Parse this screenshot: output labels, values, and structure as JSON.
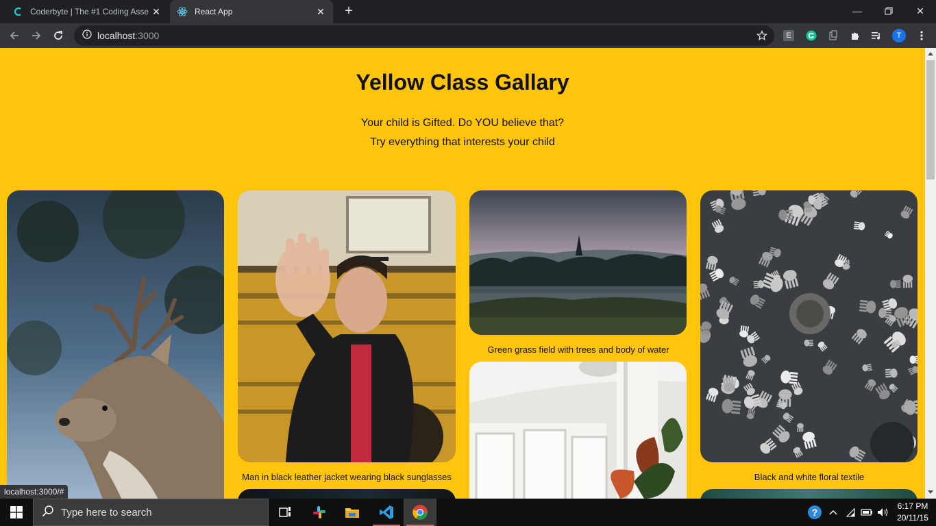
{
  "browser": {
    "tabs": [
      {
        "title": "Coderbyte | The #1 Coding Asse",
        "icon": "coderbyte-icon",
        "active": false
      },
      {
        "title": "React App",
        "icon": "react-icon",
        "active": true
      }
    ],
    "url_host": "localhost",
    "url_port": ":3000",
    "extensions": [
      "E",
      "grammarly-icon",
      "clipboard-icon",
      "puzzle-icon",
      "media-icon"
    ],
    "profile_initial": "T"
  },
  "page": {
    "title": "Yellow Class Gallary",
    "subtitle_line1": "Your child is Gifted. Do YOU believe that?",
    "subtitle_line2": "Try everything that interests your child",
    "background": "#ffc40c",
    "gallery": [
      {
        "caption": "",
        "image": "deer-with-antlers-photo"
      },
      {
        "caption": "Man in black leather jacket wearing black sunglasses",
        "image": "man-by-yellow-bus-photo"
      },
      {
        "caption": "Green grass field with trees and body of water",
        "image": "misty-landscape-photo"
      },
      {
        "caption": "Black and white floral textile",
        "image": "black-white-hands-photo"
      },
      {
        "caption": "",
        "image": "interior-room-plant-photo"
      }
    ]
  },
  "status_url": "localhost:3000/#",
  "taskbar": {
    "search_placeholder": "Type here to search",
    "time": "6:17 PM",
    "date": "20/11/15"
  }
}
